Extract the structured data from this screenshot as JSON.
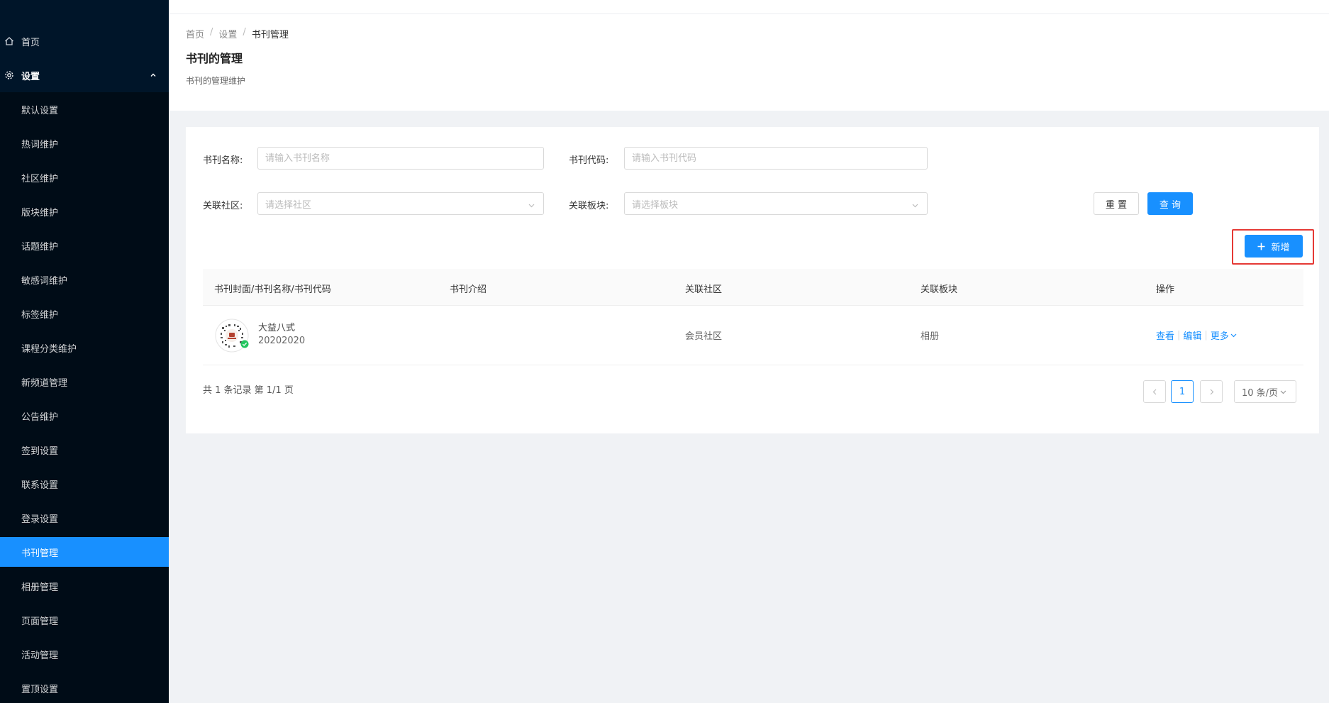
{
  "sidebar": {
    "home": {
      "label": "首页",
      "icon": "home-icon"
    },
    "settings": {
      "label": "设置",
      "icon": "gear-icon"
    },
    "items": [
      {
        "label": "默认设置"
      },
      {
        "label": "热词维护"
      },
      {
        "label": "社区维护"
      },
      {
        "label": "版块维护"
      },
      {
        "label": "话题维护"
      },
      {
        "label": "敏感词维护"
      },
      {
        "label": "标签维护"
      },
      {
        "label": "课程分类维护"
      },
      {
        "label": "新频道管理"
      },
      {
        "label": "公告维护"
      },
      {
        "label": "签到设置"
      },
      {
        "label": "联系设置"
      },
      {
        "label": "登录设置"
      },
      {
        "label": "书刊管理"
      },
      {
        "label": "相册管理"
      },
      {
        "label": "页面管理"
      },
      {
        "label": "活动管理"
      },
      {
        "label": "置顶设置"
      }
    ],
    "active_index": 13,
    "accent": "#1890ff"
  },
  "breadcrumb": {
    "home": "首页",
    "settings": "设置",
    "current": "书刊管理",
    "sep": "/"
  },
  "page": {
    "title": "书刊的管理",
    "description": "书刊的管理维护"
  },
  "filters": {
    "name": {
      "label": "书刊名称:",
      "placeholder": "请输入书刊名称"
    },
    "code": {
      "label": "书刊代码:",
      "placeholder": "请输入书刊代码"
    },
    "community": {
      "label": "关联社区:",
      "placeholder": "请选择社区"
    },
    "section": {
      "label": "关联板块:",
      "placeholder": "请选择板块"
    },
    "reset_label": "重 置",
    "search_label": "查 询"
  },
  "add_button": {
    "label": "新增",
    "icon": "plus-icon"
  },
  "table": {
    "columns": [
      "书刊封面/书刊名称/书刊代码",
      "书刊介绍",
      "关联社区",
      "关联板块",
      "操作"
    ],
    "rows": [
      {
        "name": "大益八式",
        "code": "20202020",
        "intro": "",
        "community": "会员社区",
        "section": "相册",
        "actions": {
          "view": "查看",
          "edit": "编辑",
          "more": "更多"
        }
      }
    ]
  },
  "pagination": {
    "summary": "共 1 条记录 第 1/1 页",
    "current_page": "1",
    "page_size": "10 条/页"
  }
}
